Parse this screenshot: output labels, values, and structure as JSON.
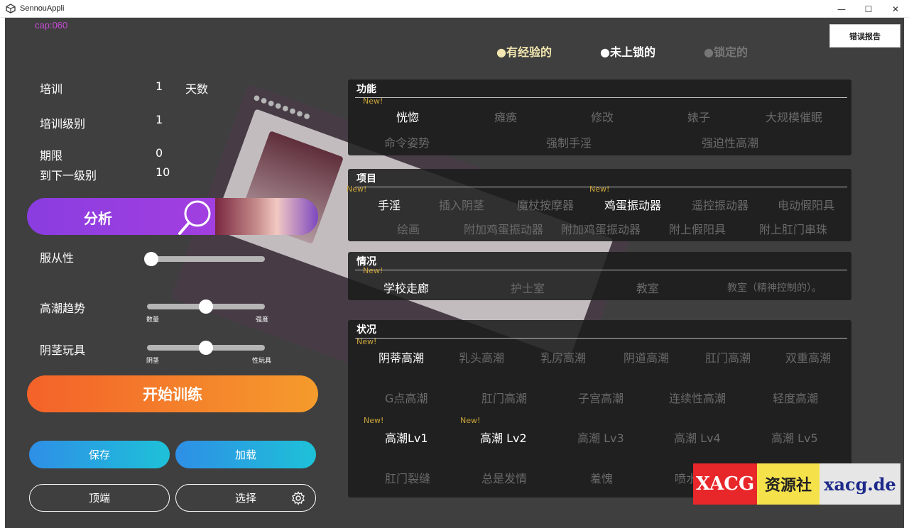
{
  "window": {
    "title": "SennouAppli",
    "minimize": "—",
    "maximize": "☐",
    "close": "✕"
  },
  "cap": "cap:060",
  "error_report": "错误报告",
  "legend": {
    "experienced": "●有经验的",
    "unlocked": "●未上锁的",
    "locked": "●锁定的"
  },
  "stats": {
    "training_label": "培训",
    "training_value": "1",
    "training_unit": "天数",
    "level_label": "培训级别",
    "level_value": "1",
    "deadline_label": "期限",
    "deadline_value": "0",
    "next_level_label": "到下一级别",
    "next_level_value": "10"
  },
  "analyze_label": "分析",
  "sliders": {
    "obedience_label": "服从性",
    "obedience_level": 0,
    "climax_label": "高潮趋势",
    "climax_left": "数量",
    "climax_right": "强度",
    "climax_level": 0.5,
    "toy_label": "阴茎玩具",
    "toy_left": "阴茎",
    "toy_right": "性玩具",
    "toy_level": 0.5
  },
  "start_training": "开始训练",
  "save": "保存",
  "load": "加载",
  "top": "顶端",
  "select": "选择",
  "new_tag": "New!",
  "panels": {
    "function": {
      "title": "功能",
      "row1": [
        "恍惚",
        "瘫痪",
        "修改",
        "婊子",
        "大规模催眠"
      ],
      "row2": [
        "命令姿势",
        "强制手淫",
        "强迫性高潮"
      ]
    },
    "item": {
      "title": "项目",
      "row1": [
        "手淫",
        "插入阴茎",
        "魔杖按摩器",
        "鸡蛋振动器",
        "遥控振动器",
        "电动假阳具"
      ],
      "row2": [
        "绘画",
        "附加鸡蛋振动器",
        "附加鸡蛋振动器",
        "附上假阳具",
        "附上肛门串珠"
      ]
    },
    "situation": {
      "title": "情况",
      "row1": [
        "学校走廊",
        "护士室",
        "教室",
        "教室（精神控制的）。"
      ]
    },
    "status": {
      "title": "状况",
      "row1": [
        "阴蒂高潮",
        "乳头高潮",
        "乳房高潮",
        "阴道高潮",
        "肛门高潮",
        "双重高潮"
      ],
      "row2": [
        "G点高潮",
        "肛门高潮",
        "子宫高潮",
        "连续性高潮",
        "轻度高潮"
      ],
      "row3": [
        "高潮Lv1",
        "高潮 Lv2",
        "高潮 Lv3",
        "高潮 Lv4",
        "高潮 Lv5"
      ],
      "row4": [
        "肛门裂缝",
        "总是发情",
        "羞愧",
        "喷水"
      ]
    }
  },
  "card": {
    "dots": "●●●●●●●●"
  },
  "watermark": {
    "a": "XACG",
    "b": "资源社",
    "c": "xacg.de"
  }
}
